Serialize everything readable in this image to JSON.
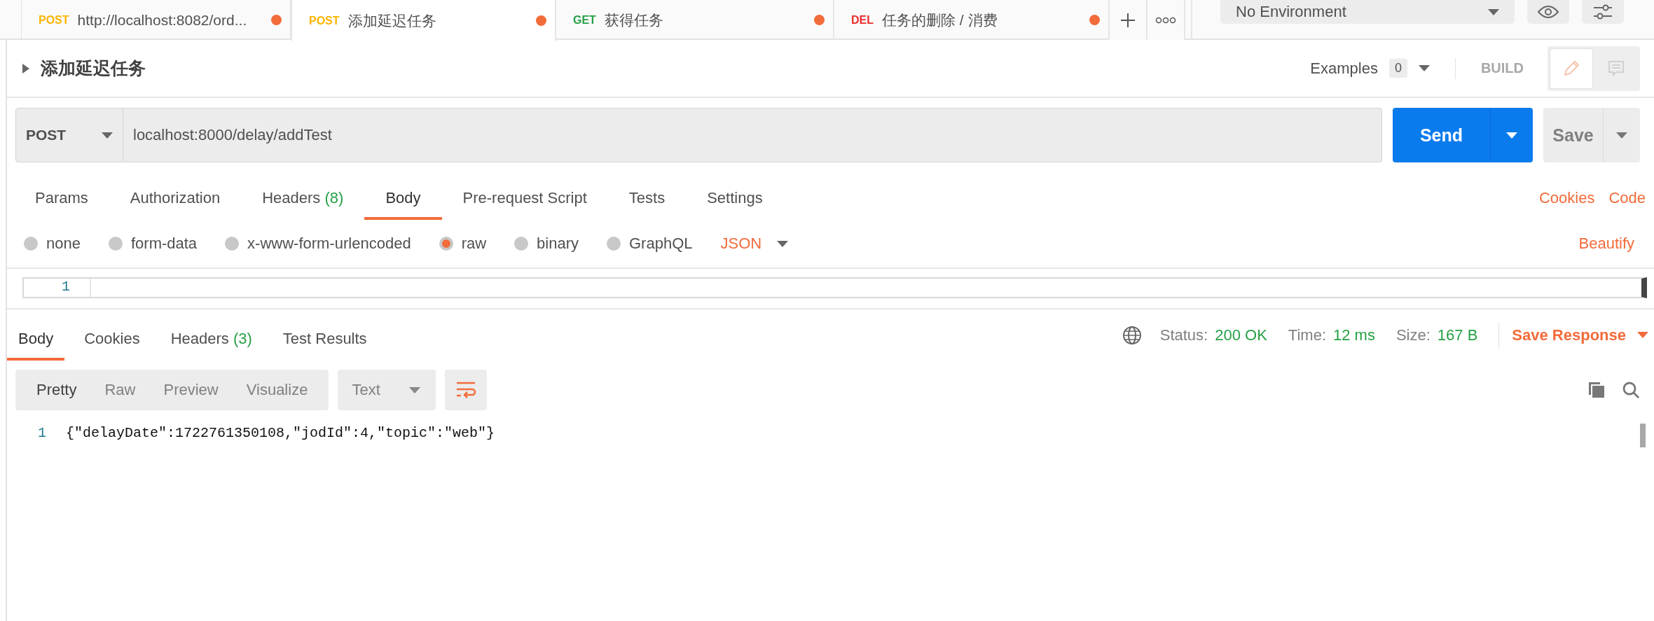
{
  "tabs": [
    {
      "method": "POST",
      "color": "#ffb400",
      "title": "http://localhost:8082/ord...",
      "selected": false,
      "modified": true
    },
    {
      "method": "POST",
      "color": "#ffb400",
      "title": "添加延迟任务",
      "selected": true,
      "modified": true
    },
    {
      "method": "GET",
      "color": "#26a046",
      "title": "获得任务",
      "selected": false,
      "modified": true
    },
    {
      "method": "DEL",
      "color": "#ed2b2b",
      "title": "任务的删除 / 消费",
      "selected": false,
      "modified": true
    }
  ],
  "environment": {
    "value": "No Environment"
  },
  "request": {
    "name": "添加延迟任务",
    "examples_label": "Examples",
    "examples_count": "0",
    "build_label": "BUILD",
    "method": "POST",
    "url": "localhost:8000/delay/addTest",
    "send_label": "Send",
    "save_label": "Save",
    "tabs": [
      {
        "label": "Params",
        "selected": false
      },
      {
        "label": "Authorization",
        "selected": false
      },
      {
        "label": "Headers",
        "count": "(8)",
        "selected": false
      },
      {
        "label": "Body",
        "selected": true
      },
      {
        "label": "Pre-request Script",
        "selected": false
      },
      {
        "label": "Tests",
        "selected": false
      },
      {
        "label": "Settings",
        "selected": false
      }
    ],
    "links": [
      "Cookies",
      "Code"
    ],
    "body_types": [
      {
        "label": "none",
        "selected": false
      },
      {
        "label": "form-data",
        "selected": false
      },
      {
        "label": "x-www-form-urlencoded",
        "selected": false
      },
      {
        "label": "raw",
        "selected": true
      },
      {
        "label": "binary",
        "selected": false
      },
      {
        "label": "GraphQL",
        "selected": false
      }
    ],
    "language": "JSON",
    "beautify_label": "Beautify",
    "modes": [
      {
        "kind": "edit",
        "selected": true
      },
      {
        "kind": "comments",
        "selected": false
      }
    ],
    "editor_lines": [
      {
        "number": "1"
      }
    ]
  },
  "response": {
    "tabs": [
      {
        "label": "Body",
        "selected": true
      },
      {
        "label": "Cookies",
        "selected": false
      },
      {
        "label": "Headers",
        "count": "(3)",
        "selected": false
      },
      {
        "label": "Test Results",
        "selected": false
      }
    ],
    "status_label": "Status:",
    "status": "200 OK",
    "time_label": "Time:",
    "time": "12 ms",
    "size_label": "Size:",
    "size": "167 B",
    "save_label": "Save Response",
    "views": [
      {
        "label": "Pretty",
        "selected": true
      },
      {
        "label": "Raw",
        "selected": false
      },
      {
        "label": "Preview",
        "selected": false
      },
      {
        "label": "Visualize",
        "selected": false
      }
    ],
    "format": "Text",
    "lines": [
      {
        "number": "1",
        "code": "{\"delayDate\":1722761350108,\"jodId\":4,\"topic\":\"web\"}"
      }
    ]
  }
}
